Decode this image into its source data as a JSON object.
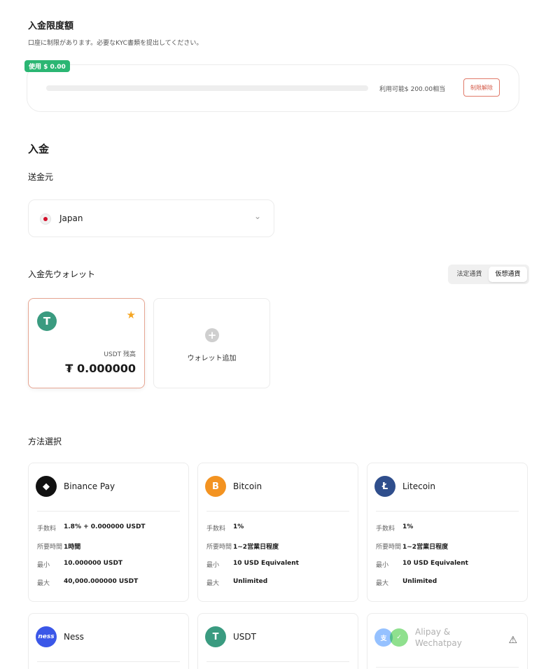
{
  "limit": {
    "title": "入金限度額",
    "description": "口座に制限があります。必要なKYC書類を提出してください。",
    "used_badge": "使用 $ 0.00",
    "used_fraction": 0,
    "available": "利用可能$ 200.00相当",
    "lift_button": "制限解除"
  },
  "deposit": {
    "title": "入金",
    "source_label": "送金元",
    "country": "Japan",
    "wallet_label": "入金先ウォレット",
    "toggle": [
      "法定通貨",
      "仮想通貨"
    ],
    "toggle_active": "仮想通貨",
    "wallet": {
      "balance_label": "USDT 残高",
      "balance": "₮ 0.000000",
      "logo_text": "T"
    },
    "add_wallet": "ウォレット追加"
  },
  "methods": {
    "title": "方法選択",
    "labels": {
      "fee": "手数料",
      "time": "所要時間",
      "min": "最小",
      "max": "最大"
    },
    "items": [
      {
        "name": "Binance Pay",
        "logo": "◆",
        "color": "#111111",
        "fee": "1.8% + 0.000000 USDT",
        "time": "1時間",
        "min": "10.000000 USDT",
        "max": "40,000.000000 USDT"
      },
      {
        "name": "Bitcoin",
        "logo": "B",
        "color": "#f39321",
        "fee": "1%",
        "time": "1~2営業日程度",
        "min": "10 USD Equivalent",
        "max": "Unlimited"
      },
      {
        "name": "Litecoin",
        "logo": "Ł",
        "color": "#2f4e8c",
        "fee": "1%",
        "time": "1~2営業日程度",
        "min": "10 USD Equivalent",
        "max": "Unlimited"
      },
      {
        "name": "Ness",
        "logo": "ness",
        "color": "#3b57e8"
      },
      {
        "name": "USDT",
        "logo": "T",
        "color": "#3a9b80"
      },
      {
        "name": "Alipay & Wechatpay",
        "name_line1": "Alipay &",
        "name_line2": "Wechatpay"
      }
    ]
  },
  "colors": {
    "accent_green": "#2bb673",
    "accent_orange": "#e6a592",
    "star": "#f5a623"
  }
}
